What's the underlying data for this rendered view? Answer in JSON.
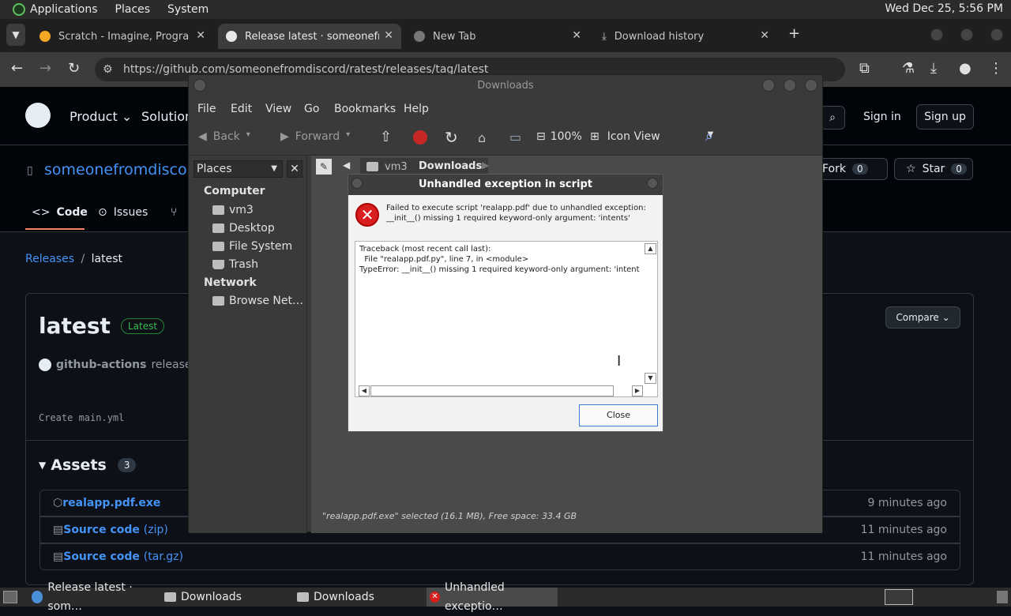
{
  "system_panel": {
    "menus": [
      "Applications",
      "Places",
      "System"
    ],
    "clock": "Wed Dec 25,  5:56 PM"
  },
  "browser": {
    "tabs": [
      {
        "label": "Scratch - Imagine, Program, Share"
      },
      {
        "label": "Release latest · someonefromdiscord/ratest"
      },
      {
        "label": "New Tab"
      },
      {
        "label": "Download history"
      }
    ],
    "url": "https://github.com/someonefromdiscord/ratest/releases/tag/latest"
  },
  "github": {
    "nav": {
      "product": "Product",
      "solutions": "Solutions",
      "sign_in": "Sign in",
      "sign_up": "Sign up"
    },
    "repo_name": "someonefromdiscord",
    "fork_label": "Fork",
    "fork_count": "0",
    "star_label": "Star",
    "star_count": "0",
    "tabs": {
      "code": "Code",
      "issues": "Issues"
    },
    "breadcrumb": {
      "releases": "Releases",
      "separator": "/",
      "current": "latest"
    },
    "release_title": "latest",
    "latest_badge": "Latest",
    "author": "github-actions",
    "released_text": "released th",
    "compare_label": "Compare",
    "commit_msg": "Create main.yml",
    "assets_label": "Assets",
    "assets_count": "3",
    "assets": [
      {
        "name": "realapp.pdf.exe",
        "suffix": "",
        "time": "9 minutes ago"
      },
      {
        "name": "Source code",
        "suffix": "(zip)",
        "time": "11 minutes ago"
      },
      {
        "name": "Source code",
        "suffix": "(tar.gz)",
        "time": "11 minutes ago"
      }
    ]
  },
  "file_manager": {
    "title": "Downloads",
    "menus": [
      "File",
      "Edit",
      "View",
      "Go",
      "Bookmarks",
      "Help"
    ],
    "toolbar": {
      "back": "Back",
      "forward": "Forward",
      "zoom": "100%",
      "view_mode": "Icon View"
    },
    "sidebar_header": "Places",
    "sections": {
      "computer": "Computer",
      "network": "Network"
    },
    "places": [
      "vm3",
      "Desktop",
      "File System",
      "Trash"
    ],
    "network_items": [
      "Browse Net…"
    ],
    "path": [
      "vm3",
      "Downloads"
    ],
    "status": "\"realapp.pdf.exe\" selected (16.1 MB), Free space: 33.4 GB"
  },
  "dialog": {
    "title": "Unhandled exception in script",
    "message": "Failed to execute script 'realapp.pdf' due to unhandled exception: __init__() missing 1 required keyword-only argument: 'intents'",
    "traceback": "Traceback (most recent call last):\n  File \"realapp.pdf.py\", line 7, in <module>\nTypeError: __init__() missing 1 required keyword-only argument: 'intents'",
    "close_label": "Close"
  },
  "taskbar": {
    "items": [
      "Release latest · som…",
      "Downloads",
      "Downloads",
      "Unhandled exceptio…"
    ]
  }
}
